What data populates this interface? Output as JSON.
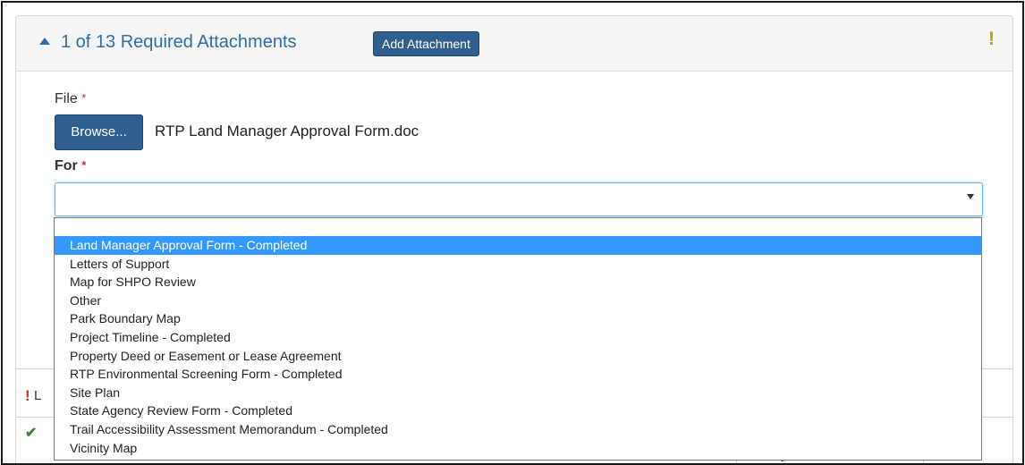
{
  "header": {
    "title": "1 of 13 Required Attachments",
    "add_button": "Add Attachment",
    "warning_glyph": "!"
  },
  "file_field": {
    "label": "File",
    "required_mark": "*",
    "browse_button": "Browse...",
    "file_name": "RTP Land Manager Approval Form.doc"
  },
  "for_field": {
    "label": "For",
    "required_mark": "*",
    "selected_value": "",
    "options": [
      "Land Manager Approval Form - Completed",
      "Letters of Support",
      "Map for SHPO Review",
      "Other",
      "Park Boundary Map",
      "Project Timeline - Completed",
      "Property Deed or Easement or Lease Agreement",
      "RTP Environmental Screening Form - Completed",
      "Site Plan",
      "State Agency Review Form - Completed",
      "Trail Accessibility Assessment Memorandum - Completed",
      "Vicinity Map"
    ],
    "highlighted_index": 0
  },
  "lower": {
    "warning_glyph": "!",
    "warning_text_fragment": "L",
    "check_glyph": "✔",
    "delete_glyph": "✕"
  },
  "colors": {
    "accent_blue": "#2f6fa5",
    "button_blue": "#2e5f8f",
    "warning_yellow": "#c2a000",
    "required_red": "#c9302c",
    "highlight": "#3399ff"
  }
}
